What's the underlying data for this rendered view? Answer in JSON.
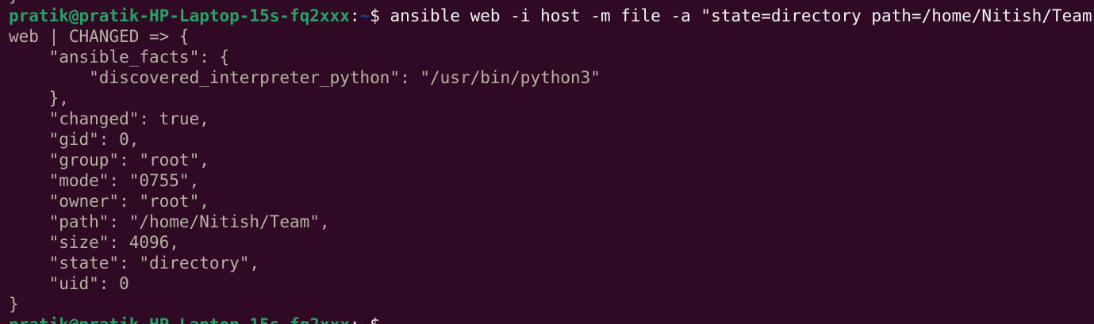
{
  "terminal": {
    "background": "#300a24",
    "colors": {
      "user_host": "#26a269",
      "path": "#12488b",
      "text": "#d3d7cf"
    },
    "prev_output": "}",
    "prompt": {
      "user_host": "pratik@pratik-HP-Laptop-15s-fq2xxx",
      "colon": ":",
      "path": "~",
      "symbol": "$ ",
      "command": "ansible web -i host -m file -a \"state=directory path=/home/Nitish/Team\" -b"
    },
    "output": [
      "web | CHANGED => {",
      "    \"ansible_facts\": {",
      "        \"discovered_interpreter_python\": \"/usr/bin/python3\"",
      "    },",
      "    \"changed\": true,",
      "    \"gid\": 0,",
      "    \"group\": \"root\",",
      "    \"mode\": \"0755\",",
      "    \"owner\": \"root\",",
      "    \"path\": \"/home/Nitish/Team\",",
      "    \"size\": 4096,",
      "    \"state\": \"directory\",",
      "    \"uid\": 0",
      "}"
    ],
    "next_prompt": {
      "user_host": "pratik@pratik-HP-Laptop-15s-fq2xxx",
      "colon": ":",
      "path": "~",
      "symbol": "$ "
    }
  }
}
